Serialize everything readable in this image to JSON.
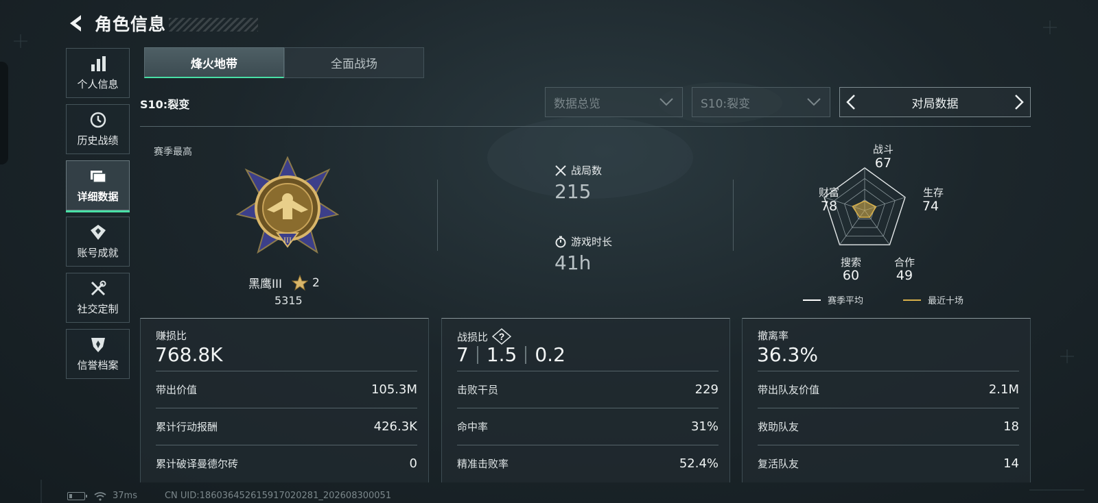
{
  "header": {
    "title": "角色信息"
  },
  "sidebar": {
    "items": [
      {
        "label": "个人信息",
        "icon": "bar-chart-icon",
        "active": false
      },
      {
        "label": "历史战绩",
        "icon": "history-icon",
        "active": false
      },
      {
        "label": "详细数据",
        "icon": "folder-icon",
        "active": true
      },
      {
        "label": "账号成就",
        "icon": "achievement-icon",
        "active": false
      },
      {
        "label": "社交定制",
        "icon": "tools-icon",
        "active": false
      },
      {
        "label": "信誉档案",
        "icon": "reputation-icon",
        "active": false
      }
    ]
  },
  "tabs": [
    {
      "label": "烽火地带",
      "active": true
    },
    {
      "label": "全面战场",
      "active": false
    }
  ],
  "season": {
    "label": "S10:裂变"
  },
  "filters": {
    "overview": "数据总览",
    "season": "S10:裂变",
    "switcher": "对局数据"
  },
  "rank": {
    "section_label": "赛季最高",
    "name": "黑鹰III",
    "stars": "2",
    "score": "5315"
  },
  "summary": {
    "matches_label": "战局数",
    "matches_value": "215",
    "playtime_label": "游戏时长",
    "playtime_value": "41h"
  },
  "radar": {
    "axes": [
      {
        "label": "战斗",
        "value": "67"
      },
      {
        "label": "生存",
        "value": "74"
      },
      {
        "label": "合作",
        "value": "49"
      },
      {
        "label": "搜索",
        "value": "60"
      },
      {
        "label": "财富",
        "value": "78"
      }
    ],
    "recent_scores": [
      0.22,
      0.28,
      0.2,
      0.2,
      0.3
    ],
    "legend": {
      "season_avg": "赛季平均",
      "recent_ten": "最近十场"
    },
    "colors": {
      "season_avg": "#ffffff",
      "recent_ten": "#d9b14a"
    }
  },
  "cards": [
    {
      "title": "赚损比",
      "big": "768.8K",
      "rows": [
        {
          "label": "带出价值",
          "value": "105.3M"
        },
        {
          "label": "累计行动报酬",
          "value": "426.3K"
        },
        {
          "label": "累计破译曼德尔砖",
          "value": "0"
        }
      ]
    },
    {
      "title": "战损比",
      "big_parts": [
        "7",
        "1.5",
        "0.2"
      ],
      "help": "?",
      "rows": [
        {
          "label": "击败干员",
          "value": "229"
        },
        {
          "label": "命中率",
          "value": "31%"
        },
        {
          "label": "精准击败率",
          "value": "52.4%"
        }
      ]
    },
    {
      "title": "撤离率",
      "big": "36.3%",
      "rows": [
        {
          "label": "带出队友价值",
          "value": "2.1M"
        },
        {
          "label": "救助队友",
          "value": "18"
        },
        {
          "label": "复活队友",
          "value": "14"
        }
      ]
    }
  ],
  "status_bar": {
    "ping": "37ms",
    "uid": "CN UID:18603645261591702028​1_202608300051"
  },
  "colors": {
    "accent": "#49e0a6",
    "gold": "#d9b14a"
  }
}
